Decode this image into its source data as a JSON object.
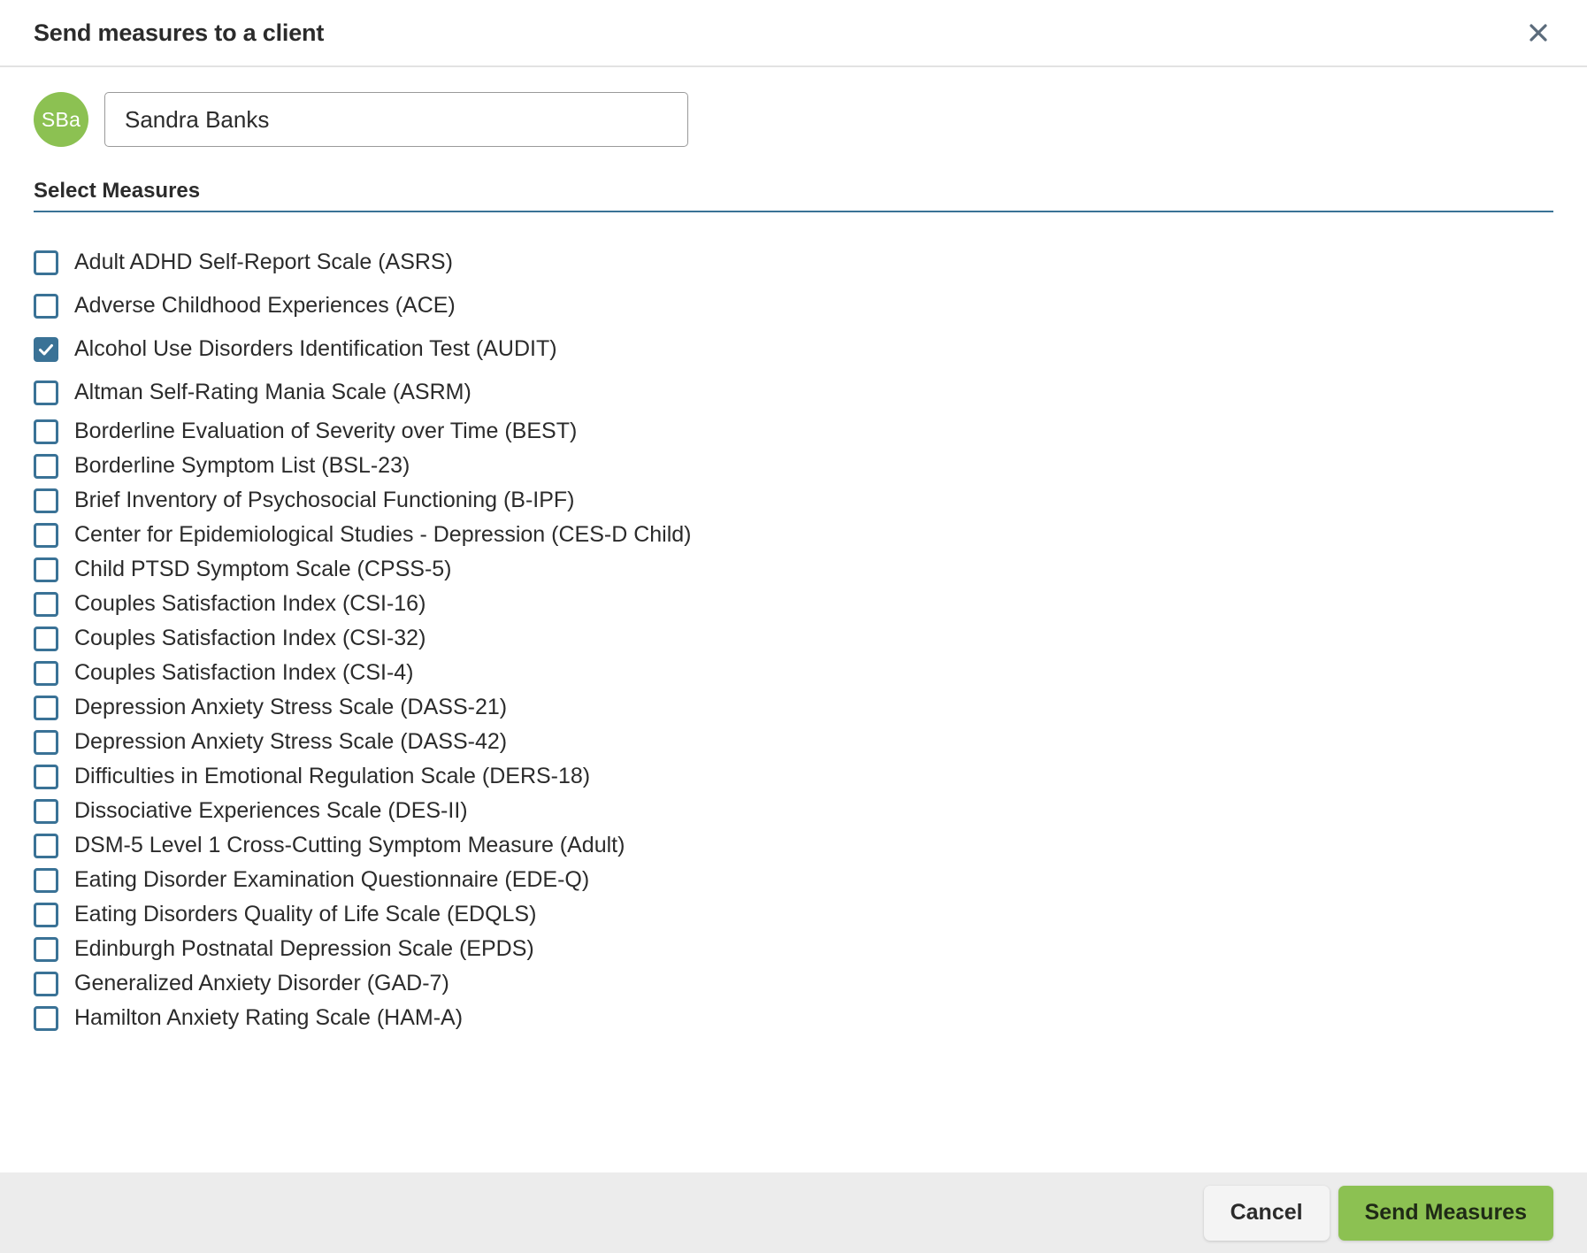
{
  "header": {
    "title": "Send measures to a client",
    "close_icon": "close-icon"
  },
  "client": {
    "avatar_initials": "SBa",
    "avatar_color": "#8cc152",
    "name_value": "Sandra Banks",
    "name_placeholder": "Client name"
  },
  "section": {
    "label": "Select Measures",
    "rule_color": "#3a7296"
  },
  "measures": [
    {
      "label": "Adult ADHD Self-Report Scale (ASRS)",
      "checked": false
    },
    {
      "label": "Adverse Childhood Experiences (ACE)",
      "checked": false
    },
    {
      "label": "Alcohol Use Disorders Identification Test (AUDIT)",
      "checked": true
    },
    {
      "label": "Altman Self-Rating Mania Scale (ASRM)",
      "checked": false
    },
    {
      "label": "Borderline Evaluation of Severity over Time (BEST)",
      "checked": false
    },
    {
      "label": "Borderline Symptom List (BSL-23)",
      "checked": false
    },
    {
      "label": "Brief Inventory of Psychosocial Functioning (B-IPF)",
      "checked": false
    },
    {
      "label": "Center for Epidemiological Studies - Depression (CES-D Child)",
      "checked": false
    },
    {
      "label": "Child PTSD Symptom Scale (CPSS-5)",
      "checked": false
    },
    {
      "label": "Couples Satisfaction Index (CSI-16)",
      "checked": false
    },
    {
      "label": "Couples Satisfaction Index (CSI-32)",
      "checked": false
    },
    {
      "label": "Couples Satisfaction Index (CSI-4)",
      "checked": false
    },
    {
      "label": "Depression Anxiety Stress Scale (DASS-21)",
      "checked": false
    },
    {
      "label": "Depression Anxiety Stress Scale (DASS-42)",
      "checked": false
    },
    {
      "label": "Difficulties in Emotional Regulation Scale (DERS-18)",
      "checked": false
    },
    {
      "label": "Dissociative Experiences Scale (DES-II)",
      "checked": false
    },
    {
      "label": "DSM-5 Level 1 Cross-Cutting Symptom Measure (Adult)",
      "checked": false
    },
    {
      "label": "Eating Disorder Examination Questionnaire (EDE-Q)",
      "checked": false
    },
    {
      "label": "Eating Disorders Quality of Life Scale (EDQLS)",
      "checked": false
    },
    {
      "label": "Edinburgh Postnatal Depression Scale (EPDS)",
      "checked": false
    },
    {
      "label": "Generalized Anxiety Disorder (GAD-7)",
      "checked": false
    },
    {
      "label": "Hamilton Anxiety Rating Scale (HAM-A)",
      "checked": false
    }
  ],
  "checkbox_colors": {
    "border": "#3a7296",
    "checked_fill": "#3a7296",
    "check_mark": "#ffffff"
  },
  "footer": {
    "cancel_label": "Cancel",
    "submit_label": "Send Measures",
    "submit_color": "#8cc152",
    "background": "#ececec"
  }
}
